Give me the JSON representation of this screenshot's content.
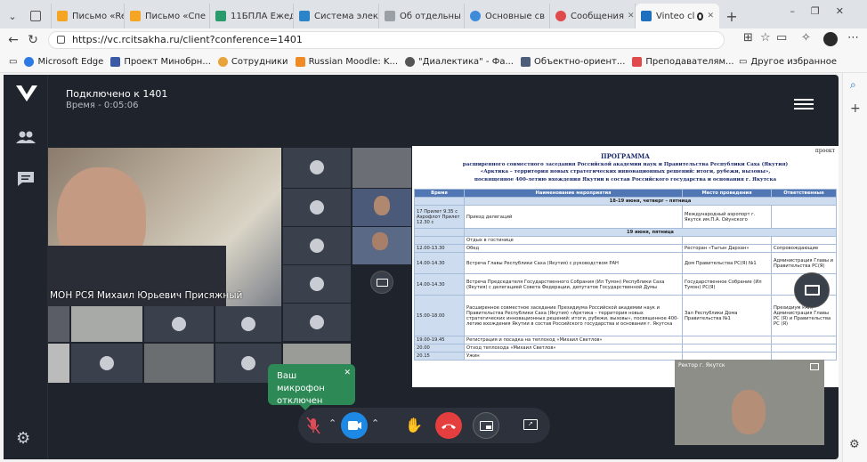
{
  "browser": {
    "tabs": [
      {
        "label": "",
        "fav": "#6b6f75"
      },
      {
        "label": "Письмо «Re:",
        "fav": "#f5a524"
      },
      {
        "label": "Письмо «Спе",
        "fav": "#f5a524"
      },
      {
        "label": "11БПЛА Ежед",
        "fav": "#2b9b6b"
      },
      {
        "label": "Система элек",
        "fav": "#2b84c7"
      },
      {
        "label": "Об отдельны",
        "fav": "#9aa0a6"
      },
      {
        "label": "Основные св",
        "fav": "#3e8bd9"
      },
      {
        "label": "Сообщения",
        "fav": "#e04a4a"
      },
      {
        "label": "Vinteo cl",
        "fav": "#1f6fbf"
      }
    ],
    "url": "https://vc.rcitsakha.ru/client?conference=1401",
    "favorites": [
      {
        "label": "Microsoft Edge",
        "fav": "#2c7be5"
      },
      {
        "label": "Проект Минобрн...",
        "fav": "#3a5aa6"
      },
      {
        "label": "Сотрудники",
        "fav": "#e8a33b"
      },
      {
        "label": "Russian Moodle: K...",
        "fav": "#f08a24"
      },
      {
        "label": "\"Диалектика\" - Фа...",
        "fav": "#555"
      },
      {
        "label": "Объектно-ориент...",
        "fav": "#4c5e7a"
      },
      {
        "label": "Преподавателям...",
        "fav": "#e04a4a"
      }
    ],
    "other_favorites": "Другое избранное"
  },
  "conference": {
    "title": "Подключено к 1401",
    "time": "Время - 0:05:06",
    "speaker_name": "МОН РСЯ Михаил Юрьевич Присяжный",
    "mic_tooltip_line1": "Ваш микрофон",
    "mic_tooltip_line2": "отключен",
    "self_label": "Ректор г. Якутск"
  },
  "slide": {
    "corner": "проект",
    "title": "ПРОГРАММА",
    "sub1": "расширенного совместного заседания Российской академии наук и Правительства Республики Саха (Якутия)",
    "sub2": "«Арктика – территория новых стратегических инновационных решений: итоги, рубежи, вызовы»,",
    "sub3": "посвященное 400-летию вхождения Якутии в состав Российского государства и основания г. Якутска",
    "headers": [
      "Время",
      "Наименование мероприятия",
      "Место проведения",
      "Ответственные"
    ],
    "band1": "18-19 июня, четверг – пятница",
    "band2": "19 июня, пятница",
    "rows": [
      {
        "time": "17 Прилет 9.35 с Аэрофлот Прилет 12.30 с",
        "event": "Приезд делегаций",
        "place": "Международный аэропорт г. Якутск им.П.А. Ойунского",
        "resp": ""
      },
      {
        "time": "",
        "event": "Отдых в гостинице",
        "place": "",
        "resp": ""
      },
      {
        "time": "12.00-13.30",
        "event": "Обед",
        "place": "Ресторан «Тыгын Дархан»",
        "resp": "Сопровождающие"
      },
      {
        "time": "14.00-14.30",
        "event": "Встреча Главы Республики Саха (Якутия) с руководством РАН",
        "place": "Дом Правительства РС(Я) №1",
        "resp": "Администрация Главы и Правительства РС(Я)"
      },
      {
        "time": "14.00-14.30",
        "event": "Встреча Председателя Государственного Собрания (Ил Тумэн) Республики Саха (Якутия) с делегацией Совета Федерации, депутатов Государственной Думы",
        "place": "Государственное Собрание (Ил Тумэн) РС(Я)",
        "resp": ""
      },
      {
        "time": "15.00-18.00",
        "event": "Расширенное совместное заседание Президиума Российской академии наук и Правительства Республики Саха (Якутия) «Арктика – территория новых стратегических инновационных решений: итоги, рубежи, вызовы», посвященное 400-летию вхождения Якутии в состав Российского государства и основания г. Якутска",
        "place": "Зал Республики Дома Правительства №1",
        "resp": "Президиум РАН, Администрация Главы РС (Я) и Правительства РС (Я)"
      },
      {
        "time": "19.00-19.45",
        "event": "Регистрация и посадка на теплоход «Михаил Светлов»",
        "place": "",
        "resp": ""
      },
      {
        "time": "20.00",
        "event": "Отход теплохода «Михаил Светлов»",
        "place": "",
        "resp": ""
      },
      {
        "time": "20.15",
        "event": "Ужин",
        "place": "",
        "resp": ""
      }
    ]
  }
}
